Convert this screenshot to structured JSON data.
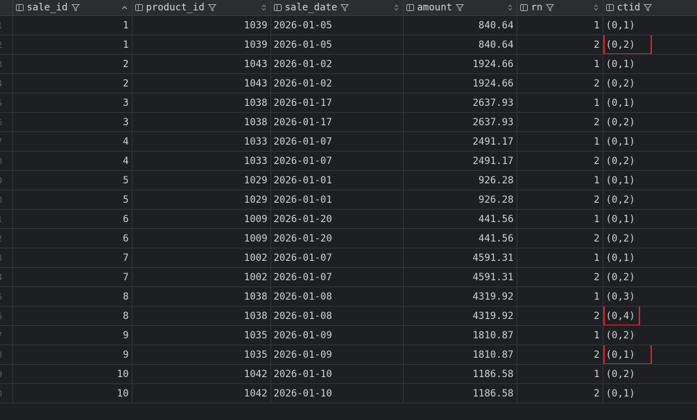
{
  "columns": [
    {
      "key": "sale_id",
      "label": "sale_id",
      "sortable": true
    },
    {
      "key": "product_id",
      "label": "product_id"
    },
    {
      "key": "sale_date",
      "label": "sale_date"
    },
    {
      "key": "amount",
      "label": "amount"
    },
    {
      "key": "rn",
      "label": "rn"
    },
    {
      "key": "ctid",
      "label": "ctid"
    }
  ],
  "rows": [
    {
      "num": "1",
      "sale_id": "1",
      "product_id": "1039",
      "sale_date": "2026-01-05",
      "amount": "840.64",
      "rn": "1",
      "ctid": "(0,1)",
      "highlight": false
    },
    {
      "num": "2",
      "sale_id": "1",
      "product_id": "1039",
      "sale_date": "2026-01-05",
      "amount": "840.64",
      "rn": "2",
      "ctid": "(0,2)",
      "highlight": true
    },
    {
      "num": "3",
      "sale_id": "2",
      "product_id": "1043",
      "sale_date": "2026-01-02",
      "amount": "1924.66",
      "rn": "1",
      "ctid": "(0,1)",
      "highlight": false
    },
    {
      "num": "4",
      "sale_id": "2",
      "product_id": "1043",
      "sale_date": "2026-01-02",
      "amount": "1924.66",
      "rn": "2",
      "ctid": "(0,2)",
      "highlight": false
    },
    {
      "num": "5",
      "sale_id": "3",
      "product_id": "1038",
      "sale_date": "2026-01-17",
      "amount": "2637.93",
      "rn": "1",
      "ctid": "(0,1)",
      "highlight": false
    },
    {
      "num": "6",
      "sale_id": "3",
      "product_id": "1038",
      "sale_date": "2026-01-17",
      "amount": "2637.93",
      "rn": "2",
      "ctid": "(0,2)",
      "highlight": false
    },
    {
      "num": "7",
      "sale_id": "4",
      "product_id": "1033",
      "sale_date": "2026-01-07",
      "amount": "2491.17",
      "rn": "1",
      "ctid": "(0,1)",
      "highlight": false
    },
    {
      "num": "8",
      "sale_id": "4",
      "product_id": "1033",
      "sale_date": "2026-01-07",
      "amount": "2491.17",
      "rn": "2",
      "ctid": "(0,2)",
      "highlight": false
    },
    {
      "num": "9",
      "sale_id": "5",
      "product_id": "1029",
      "sale_date": "2026-01-01",
      "amount": "926.28",
      "rn": "1",
      "ctid": "(0,1)",
      "highlight": false
    },
    {
      "num": "0",
      "sale_id": "5",
      "product_id": "1029",
      "sale_date": "2026-01-01",
      "amount": "926.28",
      "rn": "2",
      "ctid": "(0,2)",
      "highlight": false
    },
    {
      "num": "1",
      "sale_id": "6",
      "product_id": "1009",
      "sale_date": "2026-01-20",
      "amount": "441.56",
      "rn": "1",
      "ctid": "(0,1)",
      "highlight": false
    },
    {
      "num": "2",
      "sale_id": "6",
      "product_id": "1009",
      "sale_date": "2026-01-20",
      "amount": "441.56",
      "rn": "2",
      "ctid": "(0,2)",
      "highlight": false
    },
    {
      "num": "3",
      "sale_id": "7",
      "product_id": "1002",
      "sale_date": "2026-01-07",
      "amount": "4591.31",
      "rn": "1",
      "ctid": "(0,1)",
      "highlight": false
    },
    {
      "num": "4",
      "sale_id": "7",
      "product_id": "1002",
      "sale_date": "2026-01-07",
      "amount": "4591.31",
      "rn": "2",
      "ctid": "(0,2)",
      "highlight": false
    },
    {
      "num": "5",
      "sale_id": "8",
      "product_id": "1038",
      "sale_date": "2026-01-08",
      "amount": "4319.92",
      "rn": "1",
      "ctid": "(0,3)",
      "highlight": false
    },
    {
      "num": "6",
      "sale_id": "8",
      "product_id": "1038",
      "sale_date": "2026-01-08",
      "amount": "4319.92",
      "rn": "2",
      "ctid": "(0,4)",
      "highlight": true,
      "short": true
    },
    {
      "num": "7",
      "sale_id": "9",
      "product_id": "1035",
      "sale_date": "2026-01-09",
      "amount": "1810.87",
      "rn": "1",
      "ctid": "(0,2)",
      "highlight": false
    },
    {
      "num": "8",
      "sale_id": "9",
      "product_id": "1035",
      "sale_date": "2026-01-09",
      "amount": "1810.87",
      "rn": "2",
      "ctid": "(0,1)",
      "highlight": true
    },
    {
      "num": "9",
      "sale_id": "10",
      "product_id": "1042",
      "sale_date": "2026-01-10",
      "amount": "1186.58",
      "rn": "1",
      "ctid": "(0,2)",
      "highlight": false
    },
    {
      "num": "0",
      "sale_id": "10",
      "product_id": "1042",
      "sale_date": "2026-01-10",
      "amount": "1186.58",
      "rn": "2",
      "ctid": "(0,1)",
      "highlight": false
    }
  ],
  "colors": {
    "background": "#1e1f22",
    "header_background": "#2b2d30",
    "highlight_border": "#e0202a"
  }
}
